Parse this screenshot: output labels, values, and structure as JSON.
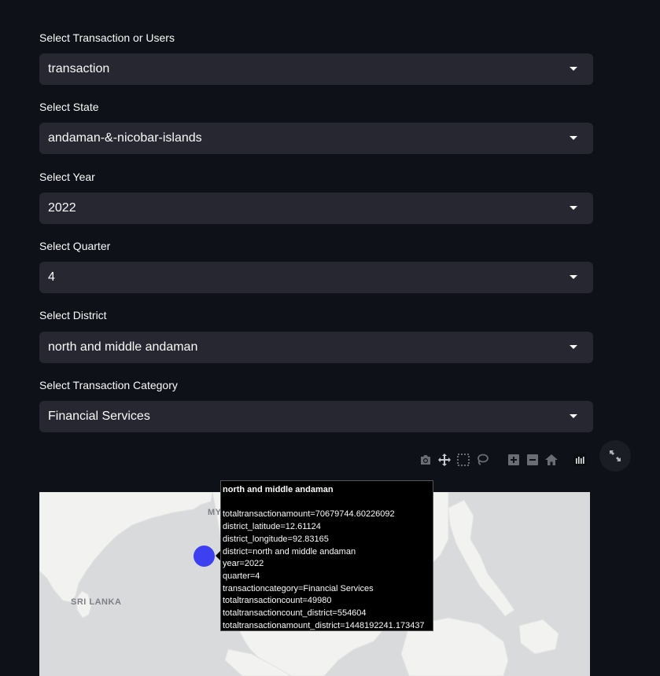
{
  "filters": [
    {
      "label": "Select Transaction or Users",
      "value": "transaction"
    },
    {
      "label": "Select State",
      "value": "andaman-&-nicobar-islands"
    },
    {
      "label": "Select Year",
      "value": "2022"
    },
    {
      "label": "Select Quarter",
      "value": "4"
    },
    {
      "label": "Select District",
      "value": "north and middle andaman"
    },
    {
      "label": "Select Transaction Category",
      "value": "Financial Services"
    }
  ],
  "toolbar": {
    "icons": [
      "camera-icon",
      "pan-icon",
      "box-select-icon",
      "lasso-icon",
      "zoom-in-icon",
      "zoom-out-icon",
      "home-icon",
      "plotly-logo-icon"
    ],
    "fullscreen_icon": "fullscreen-icon"
  },
  "map": {
    "labels": {
      "sri_lanka": "SRI LANKA",
      "myanmar_partial": "MY"
    },
    "land_color": "#f2f2f0",
    "water_color": "#d9dadc",
    "marker_color": "#3d40f0"
  },
  "tooltip": {
    "title": "north and middle andaman",
    "lines": [
      "totaltransactionamount=70679744.60226092",
      "district_latitude=12.61124",
      "district_longitude=92.83165",
      "district=north and middle andaman",
      "year=2022",
      "quarter=4",
      "transactioncategory=Financial Services",
      "totaltransactioncount=49980",
      "totaltransactioncount_district=554604",
      "totaltransactionamount_district=1448192241.173437"
    ]
  }
}
